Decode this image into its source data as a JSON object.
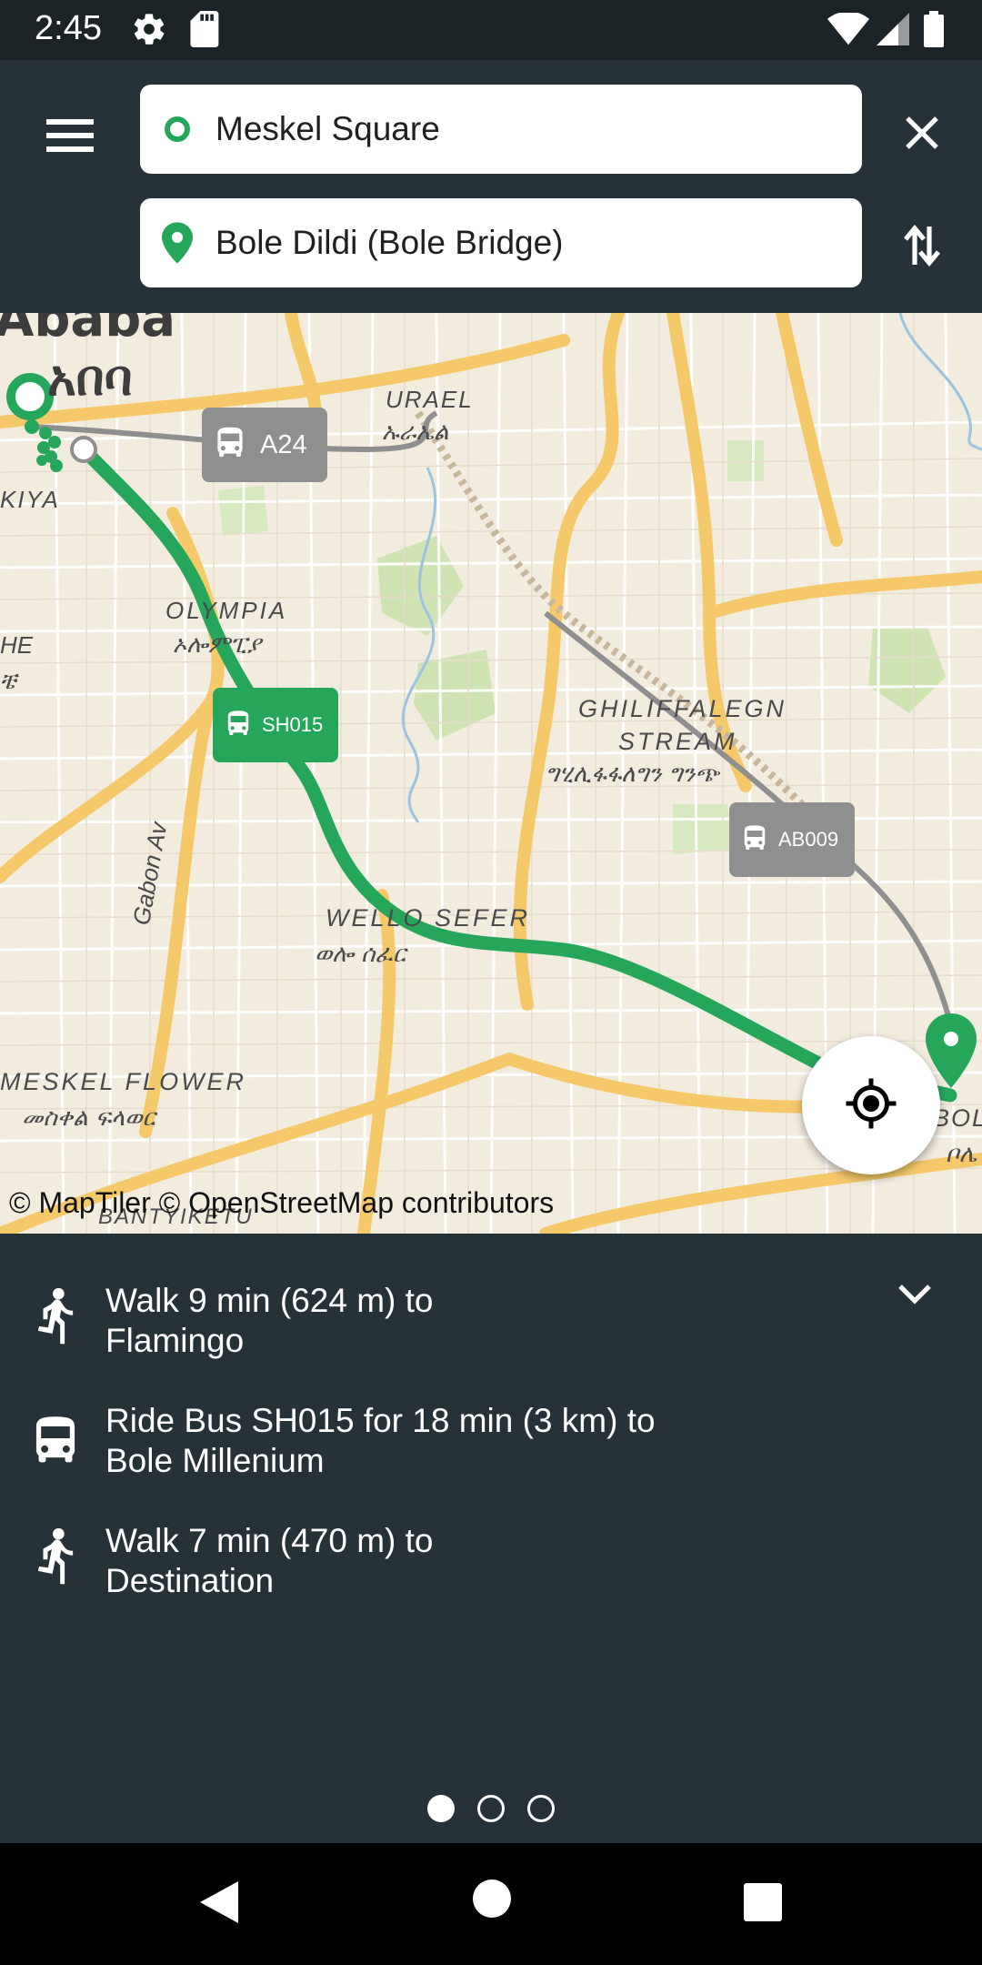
{
  "status_bar": {
    "time": "2:45",
    "icons": [
      "gear-icon",
      "sd-card-icon",
      "wifi-icon",
      "signal-icon",
      "battery-icon"
    ]
  },
  "header": {
    "origin": {
      "label": "Meskel Square",
      "icon": "origin-circle-icon"
    },
    "destination": {
      "label": "Bole Dildi (Bole Bridge)",
      "icon": "location-pin-icon"
    },
    "menu_icon": "hamburger-menu-icon",
    "clear_icon": "close-icon",
    "swap_icon": "swap-vertical-icon"
  },
  "map": {
    "attribution": "© MapTiler © OpenStreetMap contributors",
    "place_labels": [
      "Ababa",
      "አበባ",
      "URAEL",
      "ኡራኤል",
      "KIYA",
      "OLYMPIA",
      "ኦሎምፒያ",
      "HE",
      "ቼ",
      "GHILIFFALEGN",
      "STREAM",
      "ግሂሊፋፋለግን ግንጭ",
      "Gabon Av",
      "WELLO SEFER",
      "ወሎ ሰፈር",
      "MESKEL FLOWER",
      "መስቀል ፍላወር",
      "BANTYIKETU",
      "BOL",
      "ቦሌ"
    ],
    "route_badges": [
      {
        "label": "A24",
        "type": "other"
      },
      {
        "label": "SH015",
        "type": "selected"
      },
      {
        "label": "AB009",
        "type": "other"
      }
    ],
    "locate_icon": "my-location-icon"
  },
  "steps": [
    {
      "icon": "walk-icon",
      "line1": "Walk 9 min (624 m) to",
      "line2": "Flamingo"
    },
    {
      "icon": "bus-icon",
      "line1": "Ride Bus SH015 for 18 min (3 km) to",
      "line2": "Bole Millenium"
    },
    {
      "icon": "walk-icon",
      "line1": "Walk 7 min (470 m) to",
      "line2": "Destination"
    }
  ],
  "collapse_icon": "chevron-down-icon",
  "pager": {
    "count": 3,
    "active": 1
  },
  "nav_bar": [
    "back-icon",
    "home-icon",
    "recents-icon"
  ],
  "colors": {
    "header_bg": "#263238",
    "route_green": "#26a65b",
    "badge_gray": "#8f8f8f",
    "map_bg": "#f2ecdf"
  }
}
